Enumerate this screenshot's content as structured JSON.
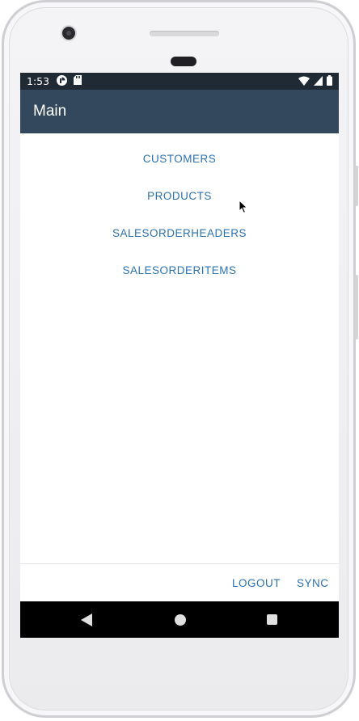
{
  "status_bar": {
    "time": "1:53"
  },
  "app_bar": {
    "title": "Main"
  },
  "main": {
    "links": [
      {
        "label": "CUSTOMERS"
      },
      {
        "label": "PRODUCTS"
      },
      {
        "label": "SALESORDERHEADERS"
      },
      {
        "label": "SALESORDERITEMS"
      }
    ]
  },
  "footer": {
    "logout_label": "LOGOUT",
    "sync_label": "SYNC"
  },
  "colors": {
    "status_bar_bg": "#1f2a35",
    "app_bar_bg": "#33475d",
    "link_color": "#2a72b2"
  },
  "icons": {
    "status_left": [
      "notification-app-icon",
      "sd-card-icon"
    ],
    "status_right": [
      "wifi-icon",
      "signal-icon",
      "battery-icon"
    ],
    "nav": [
      "back-icon",
      "home-icon",
      "recents-icon"
    ]
  }
}
